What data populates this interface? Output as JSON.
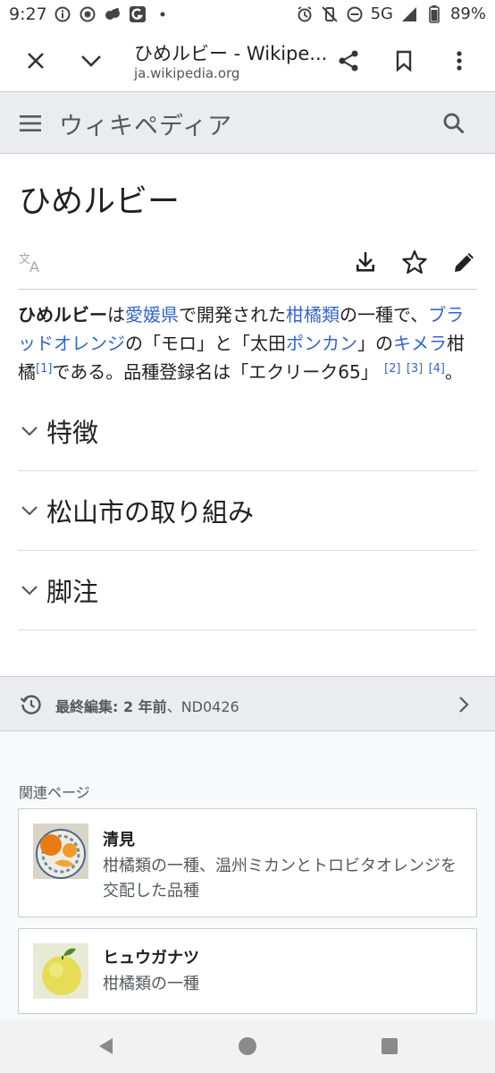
{
  "status_bar": {
    "time": "9:27",
    "network": "5G",
    "battery": "89%"
  },
  "browser": {
    "title": "ひめルビー - Wikipe...",
    "url": "ja.wikipedia.org"
  },
  "wiki": {
    "wordmark": "ウィキペディア"
  },
  "article": {
    "title": "ひめルビー",
    "lead": {
      "t1": "ひめルビー",
      "t2": "は",
      "l1": "愛媛県",
      "t3": "で開発された",
      "l2": "柑橘類",
      "t4": "の一種で、",
      "l3": "ブラッドオレンジ",
      "t5": "の「モロ」と「太田",
      "l4": "ポンカン",
      "t6": "」の",
      "l5": "キメラ",
      "t7": "柑橘",
      "r1": "[1]",
      "t8": "である。品種登録名は「エクリーク65」",
      "r2": "[2]",
      "r3": "[3]",
      "r4": "[4]",
      "t9": "。"
    },
    "sections": [
      "特徴",
      "松山市の取り組み",
      "脚注"
    ]
  },
  "last_edited": {
    "label": "最終編集: 2 年前",
    "editor": "、ND0426"
  },
  "related": {
    "heading": "関連ページ",
    "items": [
      {
        "title": "清見",
        "description": "柑橘類の一種、温州ミカンとトロビタオレンジを交配した品種"
      },
      {
        "title": "ヒュウガナツ",
        "description": "柑橘類の一種"
      }
    ]
  },
  "colors": {
    "link": "#3366cc",
    "header_bg": "#eaecf0",
    "text": "#202122"
  }
}
